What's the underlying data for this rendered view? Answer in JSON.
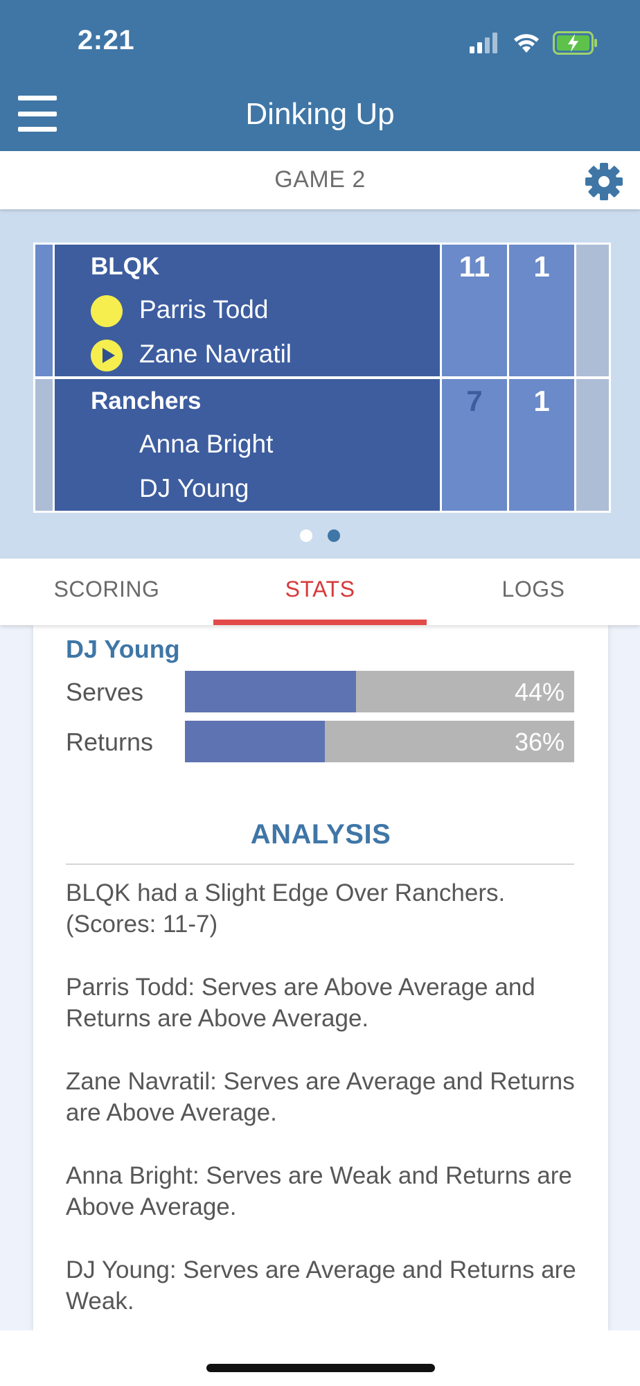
{
  "status_bar": {
    "time": "2:21"
  },
  "header": {
    "title": "Dinking Up",
    "menu_icon": "hamburger-menu-icon"
  },
  "game_bar": {
    "title": "GAME 2",
    "settings_icon": "gear-icon"
  },
  "scoreboard": {
    "teams": [
      {
        "name": "BLQK",
        "players": [
          "Parris Todd",
          "Zane Navratil"
        ],
        "game_score": "11",
        "games_won": "1",
        "serving_indicator": "yellow-dot-icon",
        "server_indicator": "play-icon"
      },
      {
        "name": "Ranchers",
        "players": [
          "Anna Bright",
          "DJ Young"
        ],
        "game_score": "7",
        "games_won": "1"
      }
    ],
    "pages": 2,
    "active_page": 2
  },
  "tabs": [
    {
      "label": "SCORING",
      "active": false
    },
    {
      "label": "STATS",
      "active": true
    },
    {
      "label": "LOGS",
      "active": false
    }
  ],
  "stats": {
    "player_name": "DJ Young",
    "rows": [
      {
        "label": "Serves",
        "value": "44%",
        "fraction": 0.44
      },
      {
        "label": "Returns",
        "value": "36%",
        "fraction": 0.36
      }
    ]
  },
  "analysis": {
    "title": "ANALYSIS",
    "paragraphs": [
      "BLQK had a Slight Edge Over Ranchers. (Scores: 11-7)",
      "Parris Todd: Serves are Above Average and Returns are Above Average.",
      "Zane Navratil: Serves are Average and Returns are Above Average.",
      "Anna Bright: Serves are Weak and Returns are Above Average.",
      "DJ Young: Serves are Average and Returns are Weak."
    ]
  },
  "colors": {
    "header": "#3f76a6",
    "team_cell": "#3d5d9f",
    "score_cell": "#6a8ac9",
    "empty_cell": "#adbdd6",
    "stat_fill": "#5e73b1",
    "stat_track": "#b5b5b5",
    "active_tab": "#d8393a",
    "serve_dot": "#f5ee4e"
  }
}
